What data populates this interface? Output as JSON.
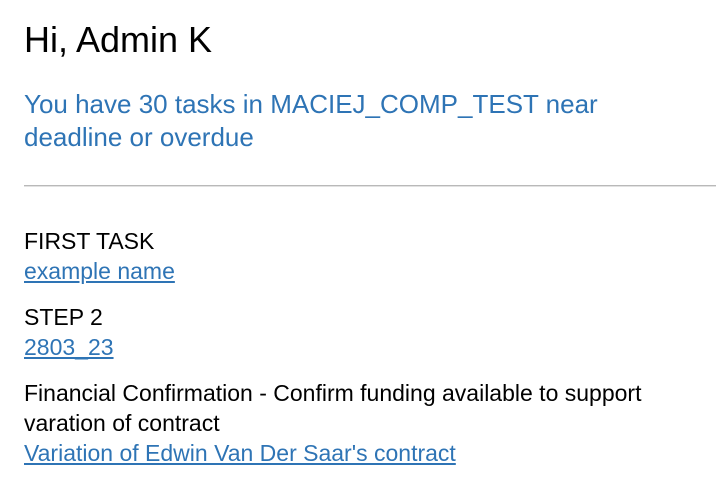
{
  "greeting": "Hi, Admin K",
  "summary": "You have 30 tasks in MACIEJ_COMP_TEST near deadline or overdue",
  "colors": {
    "link": "#2e74b5",
    "text": "#000000",
    "divider": "#b9b9b9",
    "background": "#ffffff"
  },
  "tasks": [
    {
      "title": "FIRST TASK",
      "link": "example name"
    },
    {
      "title": "STEP 2",
      "link": "2803_23"
    },
    {
      "title": "Financial Confirmation - Confirm funding available to support varation of contract",
      "link": "Variation of Edwin Van Der Saar's contract"
    }
  ]
}
